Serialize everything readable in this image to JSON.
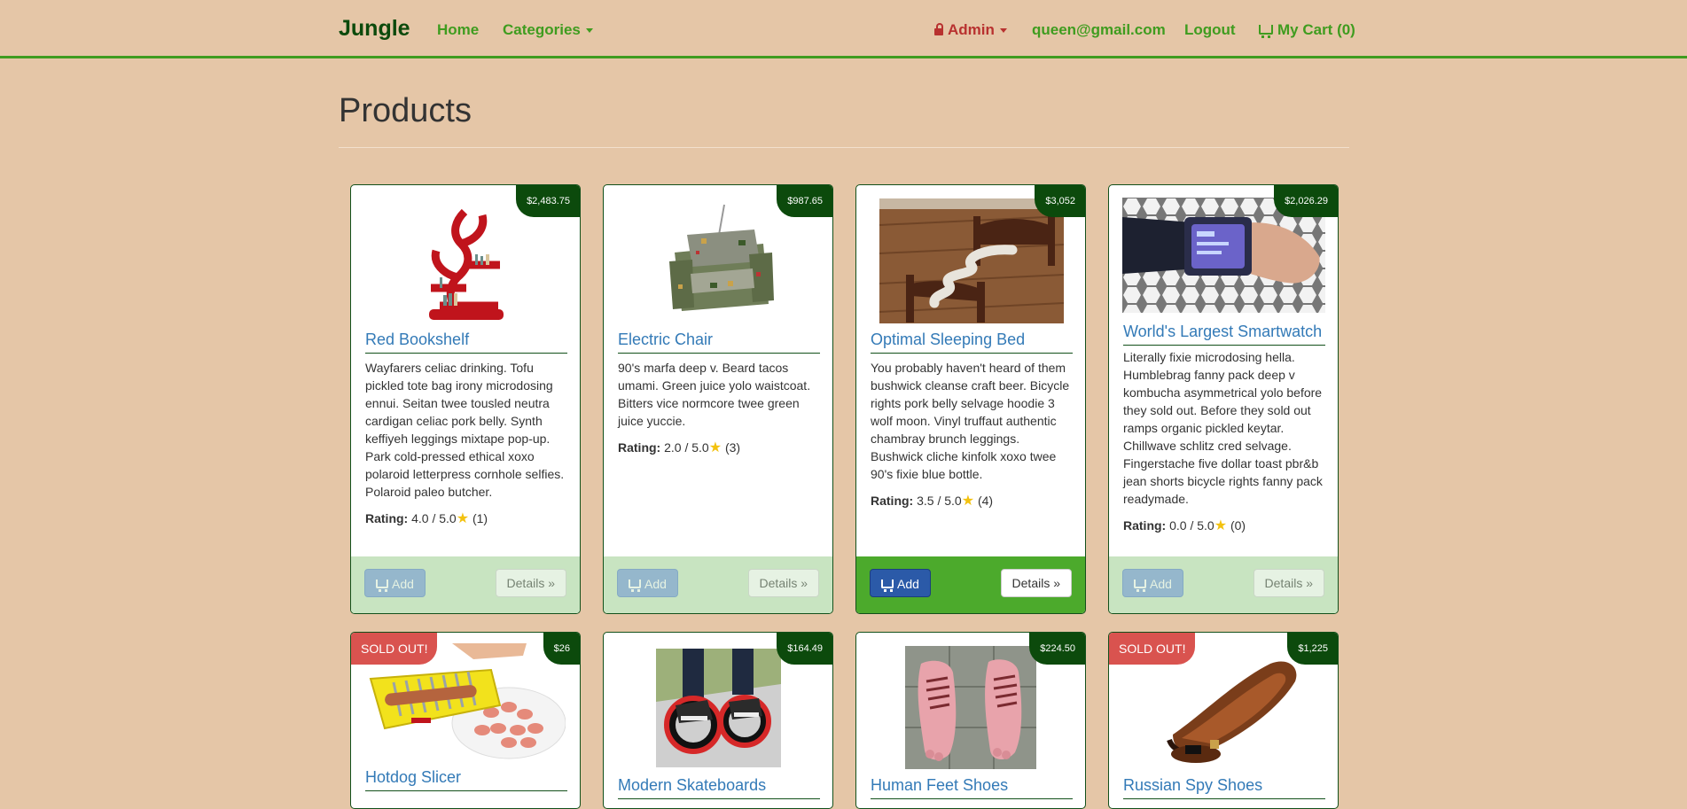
{
  "navbar": {
    "brand": "Jungle",
    "home": "Home",
    "categories": "Categories",
    "admin": "Admin",
    "email": "queen@gmail.com",
    "logout": "Logout",
    "cart": "My Cart (0)"
  },
  "page": {
    "title": "Products"
  },
  "products": [
    {
      "name": "Red Bookshelf",
      "price": "$2,483.75",
      "description": "Wayfarers celiac drinking. Tofu pickled tote bag irony microdosing ennui. Seitan twee tousled neutra cardigan celiac pork belly. Synth keffiyeh leggings mixtape pop-up. Park cold-pressed ethical xoxo polaroid letterpress cornhole selfies. Polaroid paleo butcher.",
      "rating_label": "Rating:",
      "rating": "4.0 / 5.0",
      "rating_count": "(1)",
      "add": "Add",
      "details": "Details »"
    },
    {
      "name": "Electric Chair",
      "price": "$987.65",
      "description": "90's marfa deep v. Beard tacos umami. Green juice yolo waistcoat. Bitters vice normcore twee green juice yuccie.",
      "rating_label": "Rating:",
      "rating": "2.0 / 5.0",
      "rating_count": "(3)",
      "add": "Add",
      "details": "Details »"
    },
    {
      "name": "Optimal Sleeping Bed",
      "price": "$3,052",
      "description": "You probably haven't heard of them bushwick cleanse craft beer. Bicycle rights pork belly selvage hoodie 3 wolf moon. Vinyl truffaut authentic chambray brunch leggings. Bushwick cliche kinfolk xoxo twee 90's fixie blue bottle.",
      "rating_label": "Rating:",
      "rating": "3.5 / 5.0",
      "rating_count": "(4)",
      "add": "Add",
      "details": "Details »"
    },
    {
      "name": "World's Largest Smartwatch",
      "price": "$2,026.29",
      "description": "Literally fixie microdosing hella. Humblebrag fanny pack deep v kombucha asymmetrical yolo before they sold out. Before they sold out ramps organic pickled keytar. Chillwave schlitz cred selvage. Fingerstache five dollar toast pbr&b jean shorts bicycle rights fanny pack readymade.",
      "rating_label": "Rating:",
      "rating": "0.0 / 5.0",
      "rating_count": "(0)",
      "add": "Add",
      "details": "Details »"
    },
    {
      "name": "Hotdog Slicer",
      "price": "$26",
      "badge": "SOLD OUT!"
    },
    {
      "name": "Modern Skateboards",
      "price": "$164.49"
    },
    {
      "name": "Human Feet Shoes",
      "price": "$224.50"
    },
    {
      "name": "Russian Spy Shoes",
      "price": "$1,225",
      "badge": "SOLD OUT!"
    }
  ],
  "colors": {
    "background": "#e5c6a7",
    "brand": "#0c4a0c",
    "accent": "#3f9c1f",
    "link": "#337ab7",
    "sold_out": "#d9534f",
    "star": "#f3c20f"
  }
}
